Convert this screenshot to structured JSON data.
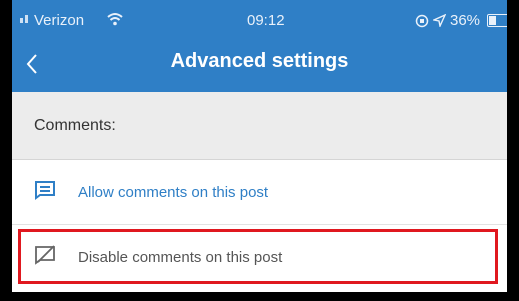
{
  "status_bar": {
    "carrier": "Verizon",
    "time": "09:12",
    "battery": "36%",
    "battery_level": 0.36
  },
  "nav": {
    "title": "Advanced settings"
  },
  "section": {
    "header": "Comments:"
  },
  "options": {
    "allow_label": "Allow comments on this post",
    "disable_label": "Disable comments on this post"
  },
  "colors": {
    "accent": "#2f7fc6",
    "highlight": "#e0181f"
  }
}
